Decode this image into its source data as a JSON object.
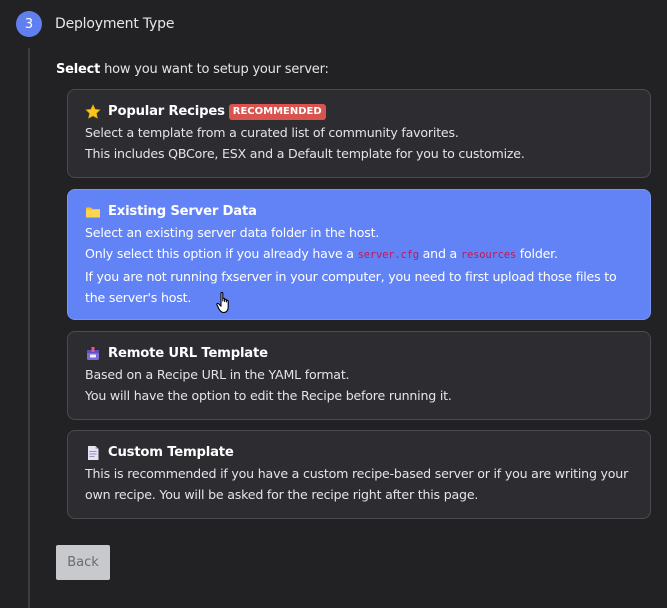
{
  "step": {
    "number": "3",
    "title": "Deployment Type"
  },
  "prompt": {
    "bold": "Select",
    "rest": " how you want to setup your server:"
  },
  "options": [
    {
      "icon": "star-icon",
      "title": "Popular Recipes",
      "badge": "RECOMMENDED",
      "lines": [
        "Select a template from a curated list of community favorites.",
        "This includes QBCore, ESX and a Default template for you to customize."
      ]
    },
    {
      "icon": "folder-icon",
      "title": "Existing Server Data",
      "selected": true,
      "line1": "Select an existing server data folder in the host.",
      "line2_a": "Only select this option if you already have a ",
      "line2_code1": "server.cfg",
      "line2_b": " and a ",
      "line2_code2": "resources",
      "line2_c": " folder.",
      "line3": "If you are not running fxserver in your computer, you need to first upload those files to",
      "line4": "the server's host."
    },
    {
      "icon": "package-icon",
      "title": "Remote URL Template",
      "lines": [
        "Based on a Recipe URL in the YAML format.",
        "You will have the option to edit the Recipe before running it."
      ]
    },
    {
      "icon": "document-icon",
      "title": "Custom Template",
      "lines": [
        "This is recommended if you have a custom recipe-based server or if you are writing your",
        "own recipe. You will be asked for the recipe right after this page."
      ]
    }
  ],
  "back_label": "Back",
  "colors": {
    "accent": "#6283f5",
    "badge": "#d9534f",
    "code": "#e83e8c"
  }
}
